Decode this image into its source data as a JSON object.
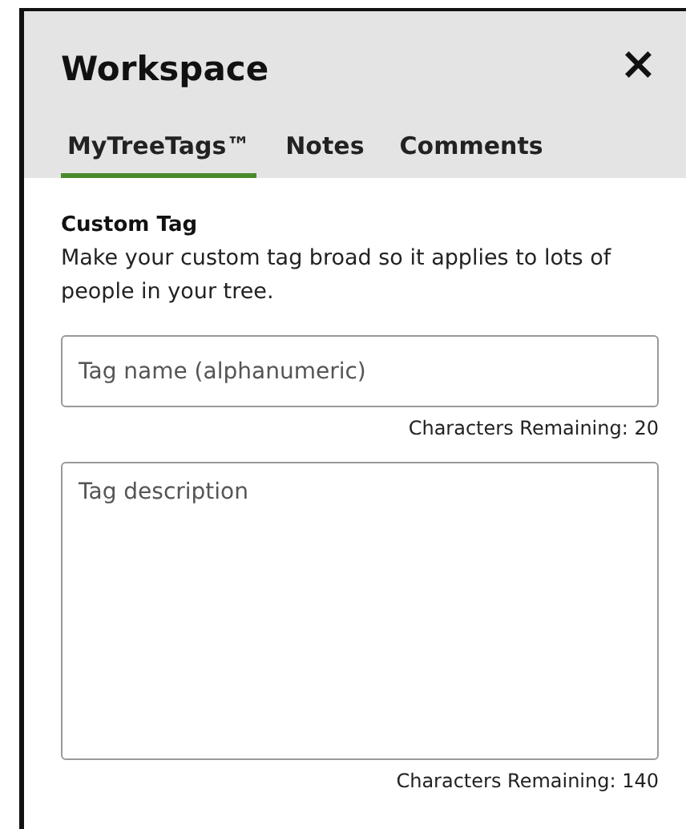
{
  "window": {
    "title": "Workspace",
    "close": "×"
  },
  "tabs": [
    {
      "label": "MyTreeTags™",
      "selected": true
    },
    {
      "label": "Notes",
      "selected": false
    },
    {
      "label": "Comments",
      "selected": false
    }
  ],
  "section": {
    "title": "Custom Tag",
    "description": "Make your custom tag broad so it applies to lots of people in your tree."
  },
  "fields": [
    {
      "kind": "input",
      "placeholder": "Tag name (alphanumeric)",
      "counter": "Characters Remaining: 20"
    },
    {
      "kind": "textarea",
      "placeholder": "Tag description",
      "counter": "Characters Remaining: 140"
    }
  ]
}
